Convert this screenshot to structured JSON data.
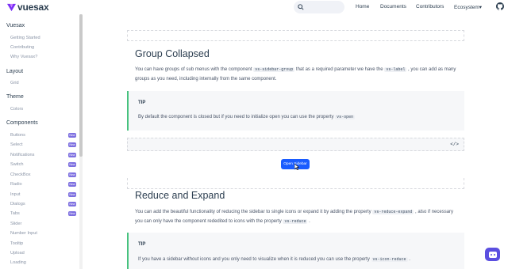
{
  "header": {
    "logo_text": "vuesax",
    "nav": [
      "Home",
      "Documents",
      "Contributors",
      "Ecosystem"
    ],
    "ecosystem_caret": "▾"
  },
  "sidebar": {
    "sections": [
      {
        "title": "Vuesax",
        "items": [
          "Getting Started",
          "Contributing",
          "Why Vuesax?"
        ]
      },
      {
        "title": "Layout",
        "items": [
          "Grid"
        ]
      },
      {
        "title": "Theme",
        "items": [
          "Colors"
        ]
      },
      {
        "title": "Components",
        "items": [
          "Buttons",
          "Select",
          "Notifications",
          "Switch",
          "CheckBox",
          "Radio",
          "Input",
          "Dialogs",
          "Tabs",
          "Slider",
          "Number Input",
          "Tooltip",
          "Upload",
          "Loading"
        ]
      }
    ],
    "badge_text": "New"
  },
  "main": {
    "section1": {
      "title": "Group Collapsed",
      "para_a": "You can have groups of sub menus with the component",
      "code_a": "vs-sidebar-group",
      "para_b": "that as a required parameter we have the",
      "code_b": "vs-label",
      "para_c": ", you can",
      "para_d": "add as many groups as you need, including internally from the same component.",
      "tip_title": "TIP",
      "tip_text": "By default the component is closed but if you need to initialize open you can use the property",
      "tip_code": "vs-open",
      "code_icon": "</>",
      "button_label": "Open Sidebar"
    },
    "section2": {
      "title": "Reduce and Expand",
      "para_a": "You can add the beautiful functionality of reducing the sidebar to single icons or expand it by adding the property",
      "code_a": "vs-reduce-expand",
      "para_b": ", also",
      "para_c": "if necessary you can only have the component rededited to icons with the property",
      "code_b": "vs-reduce",
      "para_d": ".",
      "tip_title": "TIP",
      "tip_text": "If you have a sidebar without icons and you only need to visualize when it is reduced you can use the property",
      "tip_code": "vs-icon-reduce",
      "tip_end": "."
    }
  },
  "colors": {
    "accent": "#1a5cff",
    "tip_border": "#47c27e",
    "badge": "#7d6fe0",
    "logo": "#7b2ff7"
  }
}
